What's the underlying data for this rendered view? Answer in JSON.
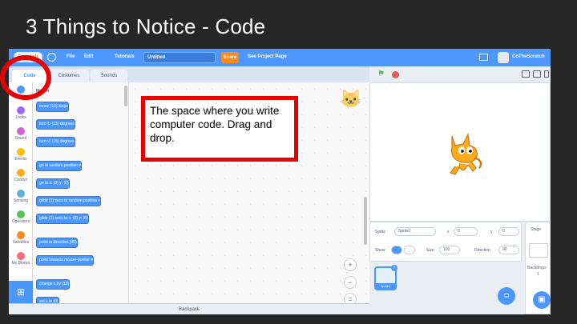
{
  "slide": {
    "title": "3 Things to Notice - Code"
  },
  "menubar": {
    "logo": "Scratch",
    "file": "File",
    "edit": "Edit",
    "tutorials": "Tutorials",
    "project_title": "Untitled",
    "share": "Share",
    "see_project_page": "See Project Page",
    "username": "CoTheScratch"
  },
  "tabs": {
    "code": "Code",
    "costumes": "Costumes",
    "sounds": "Sounds"
  },
  "categories": [
    {
      "label": "Motion",
      "color": "#4c97ff"
    },
    {
      "label": "Looks",
      "color": "#9966ff"
    },
    {
      "label": "Sound",
      "color": "#cf63cf"
    },
    {
      "label": "Events",
      "color": "#ffbf00"
    },
    {
      "label": "Control",
      "color": "#ffab19"
    },
    {
      "label": "Sensing",
      "color": "#5cb1d6"
    },
    {
      "label": "Operators",
      "color": "#59c059"
    },
    {
      "label": "Variables",
      "color": "#ff8c1a"
    },
    {
      "label": "My Blocks",
      "color": "#ff6680"
    }
  ],
  "palette": {
    "heading": "Motion",
    "blocks": [
      "move (10) steps",
      "turn ↻ (15) degrees",
      "turn ↺ (15) degrees",
      "go to random position ▾",
      "go to x: (0) y: (0)",
      "glide (1) secs to random position ▾",
      "glide (1) secs to x: (0) y: (0)",
      "point in direction (90)",
      "point towards mouse-pointer ▾",
      "change x by (10)",
      "set x to (0)"
    ]
  },
  "callout": {
    "text": "The space where you write computer code. Drag and drop."
  },
  "backpack": "Backpack",
  "sprite_info": {
    "sprite_label": "Sprite",
    "sprite_name": "Sprite1",
    "x_label": "x",
    "x_value": "0",
    "y_label": "y",
    "y_value": "0",
    "show_label": "Show",
    "size_label": "Size",
    "size_value": "100",
    "direction_label": "Direction",
    "direction_value": "90"
  },
  "sprite_list": {
    "thumb_name": "Sprite1"
  },
  "stage_panel": {
    "title": "Stage",
    "backdrops_label": "Backdrops",
    "backdrops_count": "1"
  },
  "colors": {
    "menubar": "#4d97ff",
    "highlight": "#e60000",
    "block_motion": "#4c97ff"
  }
}
